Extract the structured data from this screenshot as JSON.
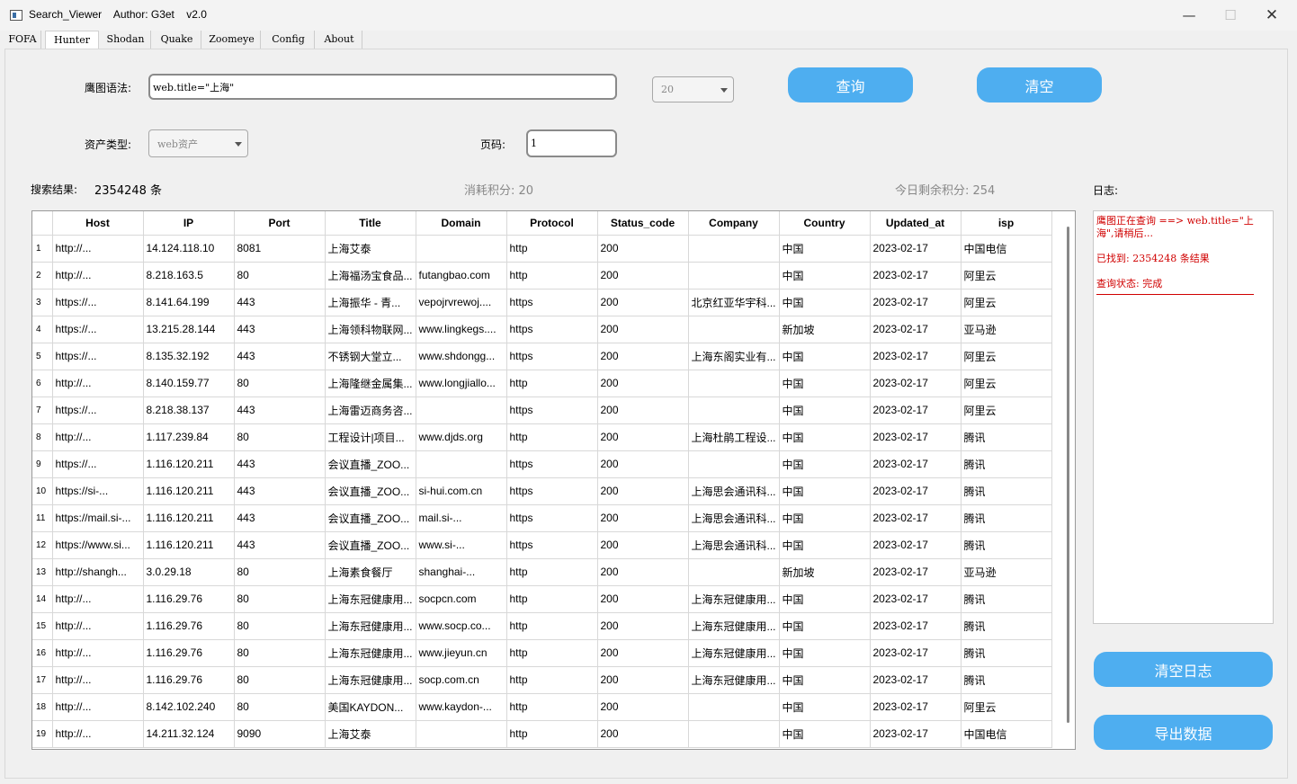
{
  "window": {
    "title": "Search_Viewer    Author: G3et    v2.0",
    "min_icon": "—",
    "max_icon": "☐",
    "close_icon": "✕"
  },
  "tabs": [
    {
      "label": "FOFA"
    },
    {
      "label": "Hunter"
    },
    {
      "label": "Shodan"
    },
    {
      "label": "Quake"
    },
    {
      "label": "Zoomeye"
    },
    {
      "label": "Config"
    },
    {
      "label": "About"
    }
  ],
  "active_tab": "Hunter",
  "form": {
    "syntax_label": "鹰图语法:",
    "syntax_value": "web.title=\"上海\"",
    "page_size_value": "20",
    "query_button": "查询",
    "clear_button": "清空",
    "asset_type_label": "资产类型:",
    "asset_type_value": "web资产",
    "page_label": "页码:",
    "page_value": "1"
  },
  "stats": {
    "result_label": "搜索结果:",
    "result_value": "2354248 条",
    "cost": "消耗积分: 20",
    "remaining": "今日剩余积分: 254"
  },
  "table": {
    "columns": [
      "Host",
      "IP",
      "Port",
      "Title",
      "Domain",
      "Protocol",
      "Status_code",
      "Company",
      "Country",
      "Updated_at",
      "isp"
    ],
    "rows": [
      [
        "1",
        "http://...",
        "14.124.118.10",
        "8081",
        "上海艾泰",
        "",
        "http",
        "200",
        "",
        "中国",
        "2023-02-17",
        "中国电信"
      ],
      [
        "2",
        "http://...",
        "8.218.163.5",
        "80",
        "上海福汤宝食品...",
        "futangbao.com",
        "http",
        "200",
        "",
        "中国",
        "2023-02-17",
        "阿里云"
      ],
      [
        "3",
        "https://...",
        "8.141.64.199",
        "443",
        "上海振华 - 青...",
        "vepojrvrewoj....",
        "https",
        "200",
        "北京红亚华宇科...",
        "中国",
        "2023-02-17",
        "阿里云"
      ],
      [
        "4",
        "https://...",
        "13.215.28.144",
        "443",
        "上海领科物联网...",
        "www.lingkegs....",
        "https",
        "200",
        "",
        "新加坡",
        "2023-02-17",
        "亚马逊"
      ],
      [
        "5",
        "https://...",
        "8.135.32.192",
        "443",
        "不锈钢大堂立...",
        "www.shdongg...",
        "https",
        "200",
        "上海东阁实业有...",
        "中国",
        "2023-02-17",
        "阿里云"
      ],
      [
        "6",
        "http://...",
        "8.140.159.77",
        "80",
        "上海隆继金属集...",
        "www.longjiallo...",
        "http",
        "200",
        "",
        "中国",
        "2023-02-17",
        "阿里云"
      ],
      [
        "7",
        "https://...",
        "8.218.38.137",
        "443",
        "上海雷迈商务咨...",
        "",
        "https",
        "200",
        "",
        "中国",
        "2023-02-17",
        "阿里云"
      ],
      [
        "8",
        "http://...",
        "1.117.239.84",
        "80",
        "工程设计|项目...",
        "www.djds.org",
        "http",
        "200",
        "上海杜鹃工程设...",
        "中国",
        "2023-02-17",
        "腾讯"
      ],
      [
        "9",
        "https://...",
        "1.116.120.211",
        "443",
        "会议直播_ZOO...",
        "",
        "https",
        "200",
        "",
        "中国",
        "2023-02-17",
        "腾讯"
      ],
      [
        "10",
        "https://si-...",
        "1.116.120.211",
        "443",
        "会议直播_ZOO...",
        "si-hui.com.cn",
        "https",
        "200",
        "上海思会通讯科...",
        "中国",
        "2023-02-17",
        "腾讯"
      ],
      [
        "11",
        "https://mail.si-...",
        "1.116.120.211",
        "443",
        "会议直播_ZOO...",
        "mail.si-...",
        "https",
        "200",
        "上海思会通讯科...",
        "中国",
        "2023-02-17",
        "腾讯"
      ],
      [
        "12",
        "https://www.si...",
        "1.116.120.211",
        "443",
        "会议直播_ZOO...",
        "www.si-...",
        "https",
        "200",
        "上海思会通讯科...",
        "中国",
        "2023-02-17",
        "腾讯"
      ],
      [
        "13",
        "http://shangh...",
        "3.0.29.18",
        "80",
        "上海素食餐厅",
        "shanghai-...",
        "http",
        "200",
        "",
        "新加坡",
        "2023-02-17",
        "亚马逊"
      ],
      [
        "14",
        "http://...",
        "1.116.29.76",
        "80",
        "上海东冠健康用...",
        "socpcn.com",
        "http",
        "200",
        "上海东冠健康用...",
        "中国",
        "2023-02-17",
        "腾讯"
      ],
      [
        "15",
        "http://...",
        "1.116.29.76",
        "80",
        "上海东冠健康用...",
        "www.socp.co...",
        "http",
        "200",
        "上海东冠健康用...",
        "中国",
        "2023-02-17",
        "腾讯"
      ],
      [
        "16",
        "http://...",
        "1.116.29.76",
        "80",
        "上海东冠健康用...",
        "www.jieyun.cn",
        "http",
        "200",
        "上海东冠健康用...",
        "中国",
        "2023-02-17",
        "腾讯"
      ],
      [
        "17",
        "http://...",
        "1.116.29.76",
        "80",
        "上海东冠健康用...",
        "socp.com.cn",
        "http",
        "200",
        "上海东冠健康用...",
        "中国",
        "2023-02-17",
        "腾讯"
      ],
      [
        "18",
        "http://...",
        "8.142.102.240",
        "80",
        "美国KAYDON...",
        "www.kaydon-...",
        "http",
        "200",
        "",
        "中国",
        "2023-02-17",
        "阿里云"
      ],
      [
        "19",
        "http://...",
        "14.211.32.124",
        "9090",
        "上海艾泰",
        "",
        "http",
        "200",
        "",
        "中国",
        "2023-02-17",
        "中国电信"
      ]
    ]
  },
  "log": {
    "label": "日志:",
    "lines": [
      "鹰图正在查询 ==> web.title=\"上海\",请稍后...",
      "已找到: 2354248 条结果",
      "查询状态: 完成"
    ],
    "clear_button": "清空日志",
    "export_button": "导出数据"
  }
}
